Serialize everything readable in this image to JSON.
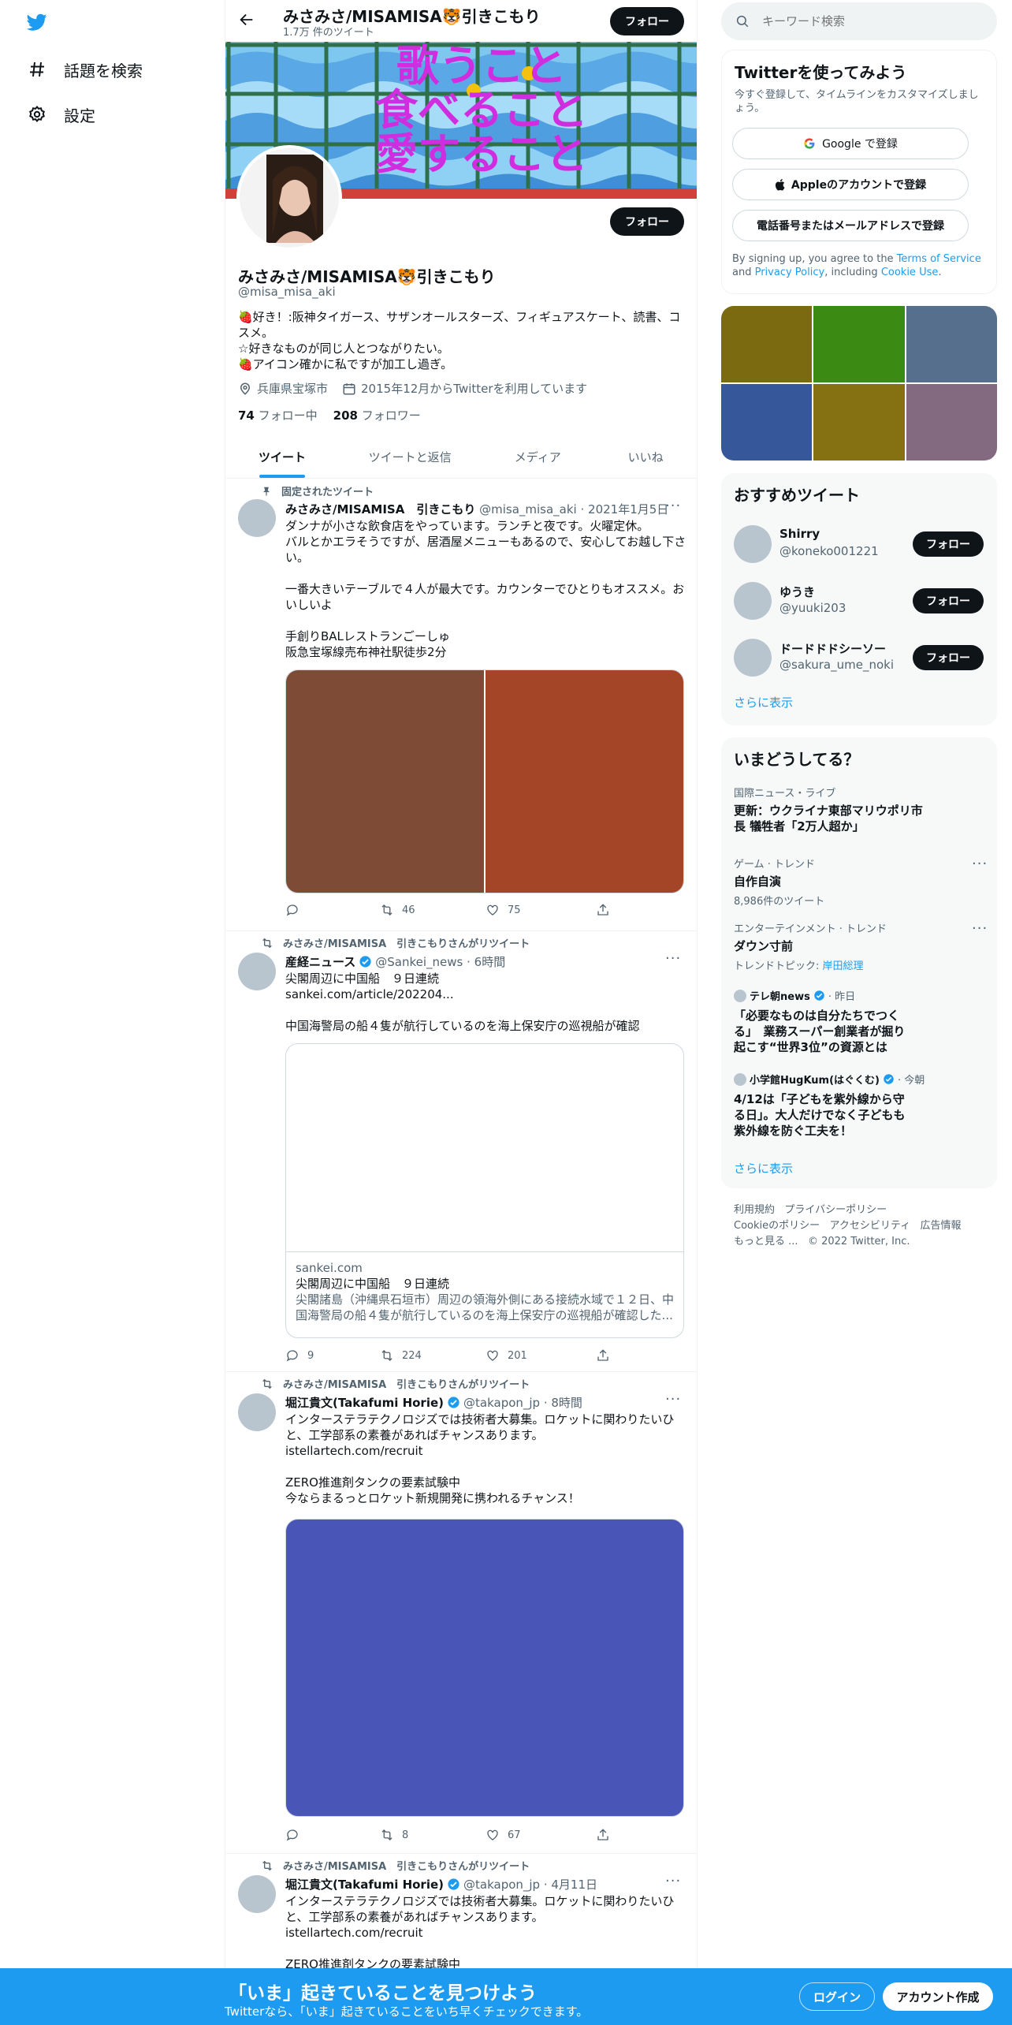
{
  "nav": {
    "explore_label": "話題を検索",
    "settings_label": "設定"
  },
  "header": {
    "name": "みさみさ/MISAMISA🐯引きこもり",
    "tweet_count": "1.7万 件のツイート",
    "follow_label": "フォロー"
  },
  "banner": {
    "lines": [
      "歌うこと",
      "食べること",
      "愛すること"
    ]
  },
  "profile": {
    "name": "みさみさ/MISAMISA🐯引きこもり",
    "handle": "@misa_misa_aki",
    "bio_line1": "🍓好き！:阪神タイガース、サザンオールスターズ、フィギュアスケート、読書、コスメ。",
    "bio_line2": "☆好きなものが同じ人とつながりたい。",
    "bio_line3": "🍓アイコン確かに私ですが加工し過ぎ。",
    "location": "兵庫県宝塚市",
    "joined": "2015年12月からTwitterを利用しています",
    "following_count": "74",
    "following_label": "フォロー中",
    "followers_count": "208",
    "followers_label": "フォロワー",
    "follow_label": "フォロー"
  },
  "tabs": [
    "ツイート",
    "ツイートと返信",
    "メディア",
    "いいね"
  ],
  "tweets": [
    {
      "context": "固定されたツイート",
      "author": "みさみさ/MISAMISA　引きこもり",
      "handle_time": "@misa_misa_aki · 2021年1月5日",
      "text": "ダンナが小さな飲食店をやっています。ランチと夜です。火曜定休。\nバルとかエラそうですが、居酒屋メニューもあるので、安心してお越し下さい。\n\n一番大きいテーブルで４人が最大です。カウンターでひとりもオススメ。おいしいよ\n\n手創りBALレストランごーしゅ\n阪急宝塚線売布神社駅徒歩2分",
      "replies": "",
      "retweets": "46",
      "likes": "75"
    },
    {
      "context": "みさみさ/MISAMISA　引きこもりさんがリツイート",
      "author": "産経ニュース",
      "handle_time": "@Sankei_news · 6時間",
      "text_line1": "尖閣周辺に中国船　９日連続",
      "link": "sankei.com/article/202204...",
      "text_line2": "中国海警局の船４隻が航行しているのを海上保安庁の巡視船が確認",
      "card_domain": "sankei.com",
      "card_title": "尖閣周辺に中国船　９日連続",
      "card_desc": "尖閣諸島（沖縄県石垣市）周辺の領海外側にある接続水域で１２日、中国海警局の船４隻が航行しているのを海上保安庁の巡視船が確認した...",
      "replies": "9",
      "retweets": "224",
      "likes": "201"
    },
    {
      "context": "みさみさ/MISAMISA　引きこもりさんがリツイート",
      "author": "堀江貴文(Takafumi Horie)",
      "handle_time": "@takapon_jp · 8時間",
      "text": "インターステラテクノロジズでは技術者大募集。ロケットに関わりたいひと、工学部系の素養があればチャンスあります。",
      "link": "istellartech.com/recruit",
      "text2": "ZERO推進剤タンクの要素試験中\n今ならまるっとロケット新規開発に携われるチャンス！",
      "replies": "",
      "retweets": "8",
      "likes": "67"
    },
    {
      "context": "みさみさ/MISAMISA　引きこもりさんがリツイート",
      "author": "堀江貴文(Takafumi Horie)",
      "handle_time": "@takapon_jp · 4月11日",
      "text": "インターステラテクノロジズでは技術者大募集。ロケットに関わりたいひと、工学部系の素養があればチャンスあります。",
      "link": "istellartech.com/recruit",
      "text2": "ZERO推進剤タンクの要素試験中"
    }
  ],
  "search": {
    "placeholder": "キーワード検索"
  },
  "signup": {
    "title": "Twitterを使ってみよう",
    "subtitle": "今すぐ登録して、タイムラインをカスタマイズしましょう。",
    "google_label": "Google で登録",
    "apple_label": "Appleのアカウントで登録",
    "phone_label": "電話番号またはメールアドレスで登録",
    "legal_pre": "By signing up, you agree to the ",
    "legal_tos": "Terms of Service",
    "legal_and": " and ",
    "legal_privacy": "Privacy Policy",
    "legal_incl": ", including ",
    "legal_cookie": "Cookie Use",
    "legal_end": "."
  },
  "media_grid_colors": [
    "#7c6a10",
    "#3b8a14",
    "#566f8c",
    "#36579a",
    "#857112",
    "#846a80"
  ],
  "who_to_follow": {
    "title": "おすすめツイート",
    "users": [
      {
        "name": "Shirry",
        "handle": "@koneko001221"
      },
      {
        "name": "ゆうき",
        "handle": "@yuuki203"
      },
      {
        "name": "ドードドドシーソー",
        "handle": "@sakura_ume_noki"
      }
    ],
    "follow_label": "フォロー",
    "more_label": "さらに表示"
  },
  "trends": {
    "title": "いまどうしてる？",
    "items": [
      {
        "category": "国際ニュース・ライブ",
        "title": "更新：ウクライナ東部マリウポリ市長 犠牲者「2万人超か」"
      },
      {
        "category": "ゲーム · トレンド",
        "title": "自作自演",
        "meta": "8,986件のツイート"
      },
      {
        "category": "エンターテインメント · トレンド",
        "title": "ダウン寸前",
        "meta_pre": "トレンドトピック: ",
        "meta_link": "岸田総理"
      },
      {
        "source": "テレ朝news",
        "time": "· 昨日",
        "title": "「必要なものは自分たちでつくる」　業務スーパー創業者が掘り起こす“世界3位”の資源とは"
      },
      {
        "source": "小学館HugKum(はぐくむ)",
        "time": "· 今朝",
        "title": "4/12は「子どもを紫外線から守る日」。大人だけでなく子どもも紫外線を防ぐ工夫を！"
      }
    ],
    "more_label": "さらに表示"
  },
  "footer": {
    "links": [
      "利用規約",
      "プライバシーポリシー",
      "Cookieのポリシー",
      "アクセシビリティ",
      "広告情報",
      "もっと見る ..."
    ],
    "copyright": "© 2022 Twitter, Inc."
  },
  "bottom_bar": {
    "title": "「いま」起きていることを見つけよう",
    "subtitle": "Twitterなら、「いま」起きていることをいち早くチェックできます。",
    "login_label": "ログイン",
    "signup_label": "アカウント作成"
  }
}
